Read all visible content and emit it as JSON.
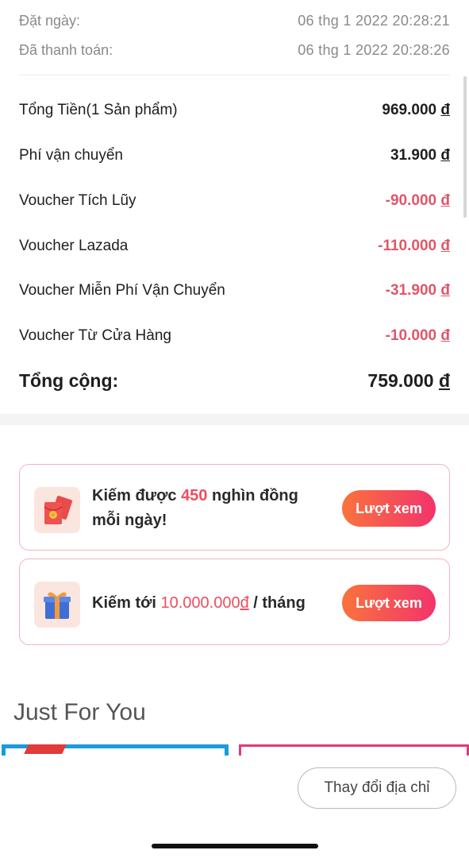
{
  "order_meta": {
    "ordered_label": "Đặt ngày:",
    "ordered_value": "06 thg 1 2022  20:28:21",
    "paid_label": "Đã thanh toán:",
    "paid_value": "06 thg 1 2022  20:28:26"
  },
  "summary": {
    "rows": [
      {
        "label": "Tổng Tiền(1 Sản phẩm)",
        "amount": "969.000",
        "currency": "đ"
      },
      {
        "label": "Phí vận chuyển",
        "amount": "31.900",
        "currency": "đ"
      },
      {
        "label": "Voucher Tích Lũy",
        "amount": "-90.000",
        "currency": "đ"
      },
      {
        "label": "Voucher Lazada",
        "amount": "-110.000",
        "currency": "đ"
      },
      {
        "label": "Voucher Miễn Phí Vận Chuyển",
        "amount": "-31.900",
        "currency": "đ"
      },
      {
        "label": "Voucher Từ Cửa Hàng",
        "amount": "-10.000",
        "currency": "đ"
      }
    ],
    "total_label": "Tổng cộng:",
    "total_amount": "759.000",
    "total_currency": "đ",
    "negative_color": "#e0566a"
  },
  "promos": [
    {
      "icon": "red-envelope-icon",
      "text_pre": "Kiếm được ",
      "text_hl": "450",
      "text_post": " nghìn đồng mỗi ngày!",
      "button": "Lượt xem"
    },
    {
      "icon": "gift-box-icon",
      "text_pre": "Kiếm tới ",
      "text_hl": "10.000.000",
      "text_hl_cur": "đ",
      "text_post": " / tháng",
      "button": "Lượt xem"
    }
  ],
  "just_for_you": {
    "title": "Just For You"
  },
  "bottom": {
    "change_address_button": "Thay đổi địa chỉ"
  },
  "colors": {
    "accent_gradient_start": "#f9733d",
    "accent_gradient_end": "#f2346b",
    "highlight": "#ee4d5f"
  }
}
